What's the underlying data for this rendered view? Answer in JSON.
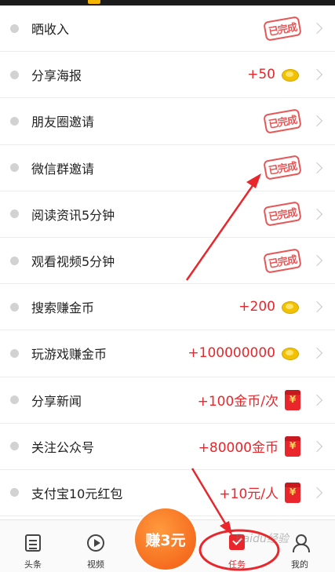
{
  "tasks": [
    {
      "label": "晒收入",
      "reward": "",
      "icon": "completed-stamp-icon",
      "stamp": "已完成"
    },
    {
      "label": "分享海报",
      "reward": "+50",
      "icon": "coin-icon"
    },
    {
      "label": "朋友圈邀请",
      "reward": "",
      "icon": "completed-stamp-icon",
      "stamp": "已完成"
    },
    {
      "label": "微信群邀请",
      "reward": "",
      "icon": "completed-stamp-icon",
      "stamp": "已完成"
    },
    {
      "label": "阅读资讯5分钟",
      "reward": "",
      "icon": "completed-stamp-icon",
      "stamp": "已完成"
    },
    {
      "label": "观看视频5分钟",
      "reward": "",
      "icon": "completed-stamp-icon",
      "stamp": "已完成"
    },
    {
      "label": "搜索赚金币",
      "reward": "+200",
      "icon": "coin-icon"
    },
    {
      "label": "玩游戏赚金币",
      "reward": "+100000000",
      "icon": "coin-icon"
    },
    {
      "label": "分享新闻",
      "reward": "+100金币/次",
      "icon": "red-packet-icon"
    },
    {
      "label": "关注公众号",
      "reward": "+80000金币",
      "icon": "red-packet-icon"
    },
    {
      "label": "支付宝10元红包",
      "reward": "+10元/人",
      "icon": "red-packet-icon"
    }
  ],
  "tabbar": {
    "tabs": [
      {
        "label": "头条",
        "icon": "news-icon"
      },
      {
        "label": "视频",
        "icon": "video-icon"
      },
      {
        "label": "任务",
        "icon": "task-icon",
        "active": true
      },
      {
        "label": "我的",
        "icon": "user-icon"
      }
    ],
    "earn_badge": "赚3元"
  },
  "watermark": "Baidu经验",
  "colors": {
    "accent": "#e8262b",
    "badge": "#f25a12",
    "coin": "#f2c200"
  }
}
